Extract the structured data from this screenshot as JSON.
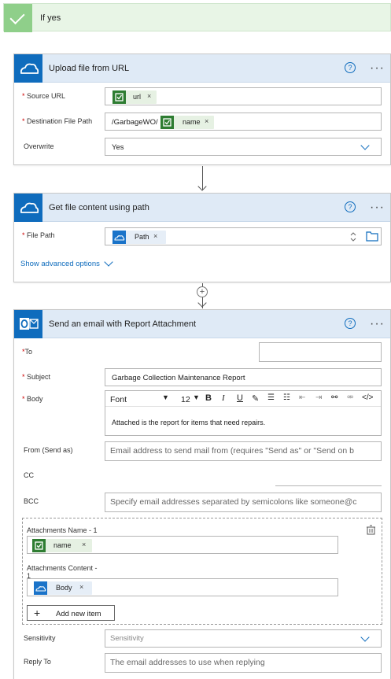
{
  "condition": {
    "label": "If yes"
  },
  "upload": {
    "title": "Upload file from URL",
    "source_url_label": "Source URL",
    "source_url_token": "url",
    "dest_label": "Destination File Path",
    "dest_prefix": "/GarbageWO/",
    "dest_token": "name",
    "overwrite_label": "Overwrite",
    "overwrite_value": "Yes"
  },
  "getfile": {
    "title": "Get file content using path",
    "path_label": "File Path",
    "path_token": "Path",
    "advanced_link": "Show advanced options"
  },
  "email": {
    "title": "Send an email with Report Attachment",
    "to_label": "To",
    "subject_label": "Subject",
    "subject_value": "Garbage Collection Maintenance Report",
    "body_label": "Body",
    "font_name": "Font",
    "font_size": "12",
    "body_text": "Attached is the report for items that need repairs.",
    "from_label": "From (Send as)",
    "from_placeholder": "Email address to send mail from (requires \"Send as\" or \"Send on b",
    "cc_label": "CC",
    "bcc_label": "BCC",
    "bcc_placeholder": "Specify email addresses separated by semicolons like someone@c",
    "att_name_label": "Attachments Name - 1",
    "att_name_token": "name",
    "att_content_label": "Attachments Content -",
    "att_content_label2": "1",
    "att_content_token": "Body",
    "add_item": "Add new item",
    "sensitivity_label": "Sensitivity",
    "sensitivity_placeholder": "Sensitivity",
    "reply_label": "Reply To",
    "reply_placeholder": "The email addresses to use when replying"
  },
  "common": {
    "help": "?",
    "more": "···",
    "required_mark": "*",
    "token_close": "×"
  },
  "colors": {
    "accent": "#0f6cbd",
    "token_green": "#2e7d32",
    "success": "#8fcf8a"
  }
}
